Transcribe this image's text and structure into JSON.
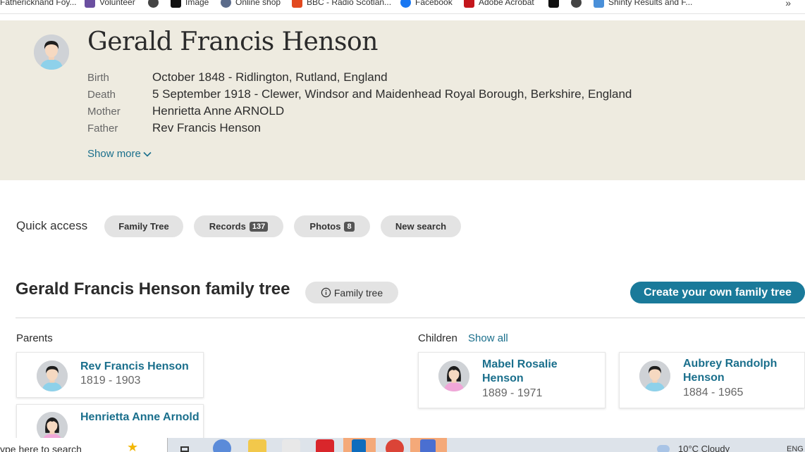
{
  "bookmarks": [
    {
      "label": "Fathericknand Foy...",
      "icon": "bookmark-icon",
      "color": "#8a8a8a"
    },
    {
      "label": "Volunteer",
      "icon": "purple-square-icon",
      "color": "#6b4fa0"
    },
    {
      "label": "Image",
      "icon": "x-logo-icon",
      "color": "#111111"
    },
    {
      "label": "Online shop",
      "icon": "globe-icon",
      "color": "#5b6b8a"
    },
    {
      "label": "BBC - Radio Scotlan...",
      "icon": "bbc-icon",
      "color": "#e2491f"
    },
    {
      "label": "Facebook",
      "icon": "facebook-icon",
      "color": "#1877f2"
    },
    {
      "label": "Adobe Acrobat",
      "icon": "acrobat-icon",
      "color": "#c4161c"
    },
    {
      "label": "Shinty Results and F...",
      "icon": "shinty-icon",
      "color": "#4a90d9"
    }
  ],
  "bookmarks_overflow": "»",
  "person": {
    "name": "Gerald Francis Henson",
    "facts": [
      {
        "label": "Birth",
        "value": "October 1848 - Ridlington, Rutland, England"
      },
      {
        "label": "Death",
        "value": "5 September 1918 - Clewer, Windsor and Maidenhead Royal Borough, Berkshire, England"
      },
      {
        "label": "Mother",
        "value": "Henrietta Anne ARNOLD"
      },
      {
        "label": "Father",
        "value": "Rev Francis Henson"
      }
    ],
    "show_more": "Show more"
  },
  "quick_access": {
    "label": "Quick access",
    "buttons": [
      {
        "label": "Family Tree",
        "count": ""
      },
      {
        "label": "Records",
        "count": "137"
      },
      {
        "label": "Photos",
        "count": "8"
      },
      {
        "label": "New search",
        "count": ""
      }
    ]
  },
  "family_tree": {
    "title": "Gerald Francis Henson family tree",
    "badge": "Family tree",
    "cta": "Create your own family tree",
    "parents_label": "Parents",
    "children_label": "Children",
    "show_all": "Show all",
    "parents": [
      {
        "name": "Rev Francis Henson",
        "dates": "1819 - 1903",
        "gender": "male"
      },
      {
        "name": "Henrietta Anne Arnold",
        "dates": "",
        "gender": "female"
      }
    ],
    "children": [
      {
        "name": "Mabel Rosalie Henson",
        "dates": "1889 - 1971",
        "gender": "female"
      },
      {
        "name": "Aubrey Randolph Henson",
        "dates": "1884 - 1965",
        "gender": "male"
      }
    ]
  },
  "taskbar": {
    "search_text": "ype here to search",
    "weather": "10°C  Cloudy",
    "lang": "ENG"
  },
  "colors": {
    "accent": "#1a7a9a",
    "link": "#1a6f8c",
    "hero_bg": "#eeebe0"
  }
}
